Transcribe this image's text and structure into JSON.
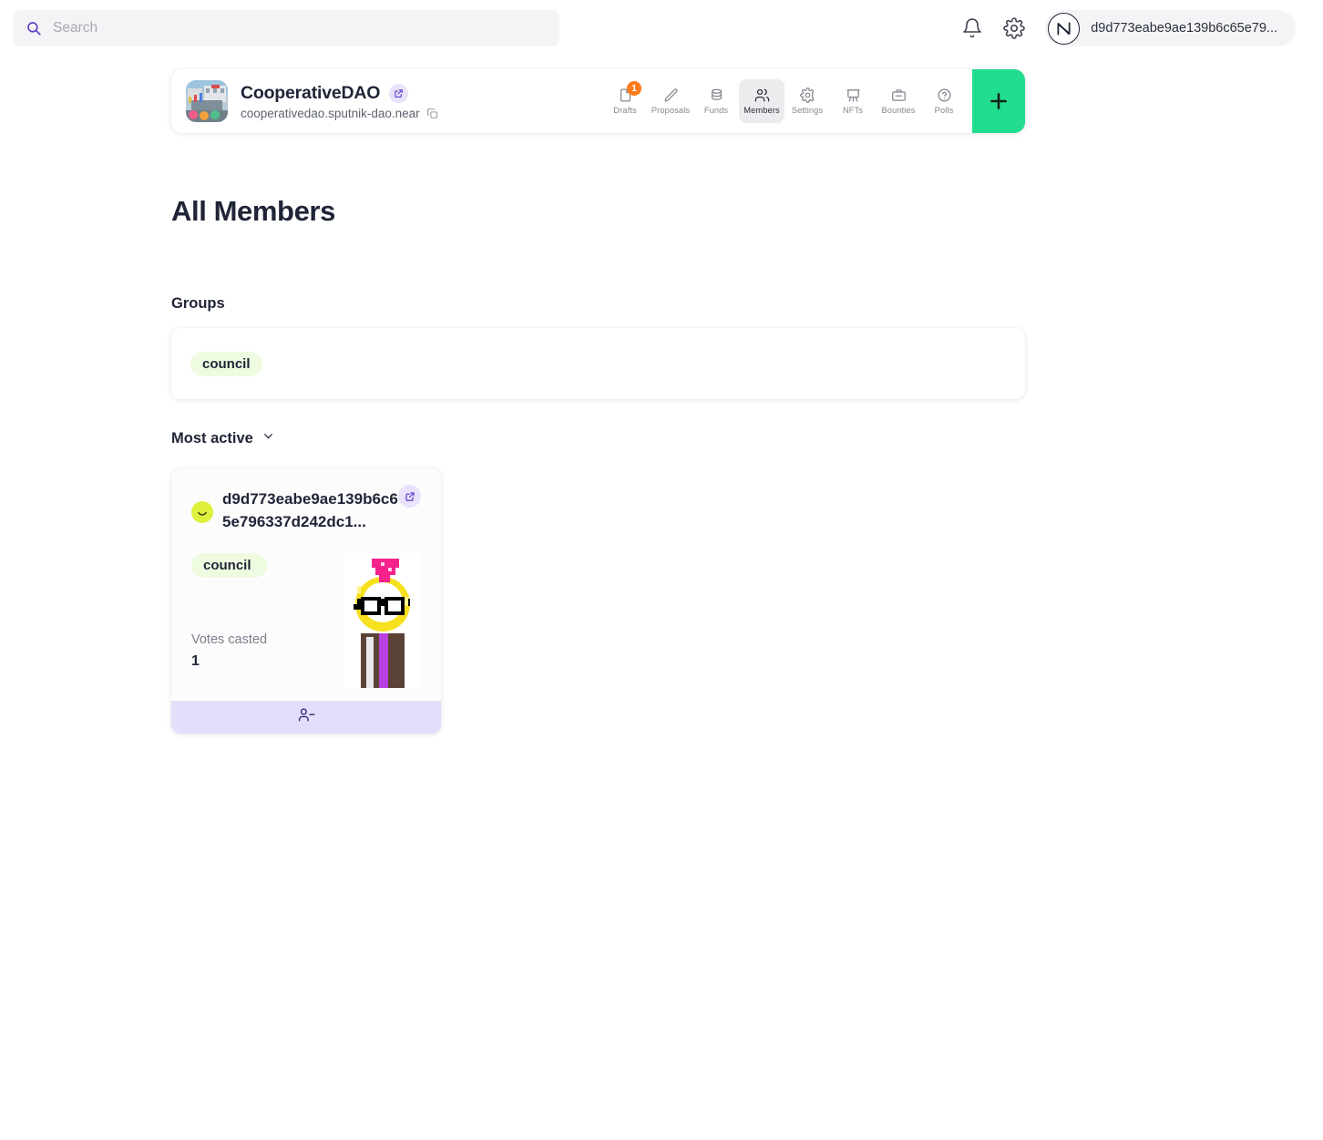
{
  "topbar": {
    "search": {
      "placeholder": "Search",
      "value": "",
      "icon": "search-icon"
    },
    "notifications_icon": "bell-icon",
    "settings_icon": "gear-icon",
    "account": {
      "logo": "near-logo",
      "name": "d9d773eabe9ae139b6c65e79..."
    }
  },
  "dao": {
    "name": "CooperativeDAO",
    "address": "cooperativedao.sputnik-dao.near",
    "logo_icon": "dao-avatar-image",
    "external_link_icon": "external-link-icon",
    "copy_icon": "copy-icon",
    "add_button_label": "+",
    "add_button_color": "#23dd8f",
    "nav": [
      {
        "label": "Drafts",
        "icon": "document-icon",
        "active": false,
        "badge": "1"
      },
      {
        "label": "Proposals",
        "icon": "pencil-icon",
        "active": false,
        "badge": ""
      },
      {
        "label": "Funds",
        "icon": "coins-icon",
        "active": false,
        "badge": ""
      },
      {
        "label": "Members",
        "icon": "users-icon",
        "active": true,
        "badge": ""
      },
      {
        "label": "Settings",
        "icon": "gear-icon",
        "active": false,
        "badge": ""
      },
      {
        "label": "NFTs",
        "icon": "easel-icon",
        "active": false,
        "badge": ""
      },
      {
        "label": "Bounties",
        "icon": "briefcase-icon",
        "active": false,
        "badge": ""
      },
      {
        "label": "Polls",
        "icon": "question-circle-icon",
        "active": false,
        "badge": ""
      }
    ]
  },
  "main": {
    "page_title": "All Members",
    "groups_label": "Groups",
    "groups": [
      {
        "name": "council",
        "color": "#effbe0"
      }
    ],
    "sort": {
      "label": "Most active",
      "icon": "chevron-down-icon"
    },
    "members": [
      {
        "account_id": "d9d773eabe9ae139b6c65e796337d242dc1...",
        "avatar_icon": "smiley-avatar",
        "external_link_icon": "external-link-icon",
        "group": "council",
        "votes_label": "Votes casted",
        "votes_value": "1",
        "nft_icon": "pixel-art-nft",
        "remove_icon": "remove-user-icon"
      }
    ]
  },
  "colors": {
    "accent_green": "#23dd8f",
    "accent_purple": "#5f4bb6",
    "badge_orange": "#ff7a1a",
    "chip_green": "#effbe0",
    "footer_lavender": "#e4ddfb",
    "text_dark": "#1f2437"
  }
}
